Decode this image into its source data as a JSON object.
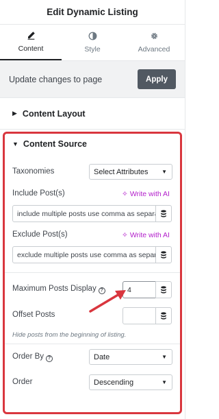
{
  "header": {
    "title": "Edit Dynamic Listing"
  },
  "tabs": [
    {
      "label": "Content",
      "icon": "pencil-icon",
      "active": true
    },
    {
      "label": "Style",
      "icon": "contrast-icon",
      "active": false
    },
    {
      "label": "Advanced",
      "icon": "gear-icon",
      "active": false
    }
  ],
  "update": {
    "text": "Update changes to page",
    "apply_label": "Apply"
  },
  "sections": {
    "content_layout": {
      "title": "Content Layout"
    },
    "content_source": {
      "title": "Content Source"
    }
  },
  "fields": {
    "taxonomies": {
      "label": "Taxonomies",
      "value": "Select Attributes"
    },
    "include_posts": {
      "label": "Include Post(s)",
      "ai_label": "Write with AI",
      "placeholder": "include multiple posts use comma as separator"
    },
    "exclude_posts": {
      "label": "Exclude Post(s)",
      "ai_label": "Write with AI",
      "placeholder": "exclude multiple posts use comma as separator"
    },
    "max_posts": {
      "label": "Maximum Posts Display",
      "value": "4"
    },
    "offset_posts": {
      "label": "Offset Posts",
      "value": "",
      "hint": "Hide posts from the beginning of listing."
    },
    "order_by": {
      "label": "Order By",
      "value": "Date"
    },
    "order": {
      "label": "Order",
      "value": "Descending"
    }
  },
  "colors": {
    "highlight": "#d9363e",
    "ai": "#b21ecb",
    "apply_bg": "#515962"
  }
}
